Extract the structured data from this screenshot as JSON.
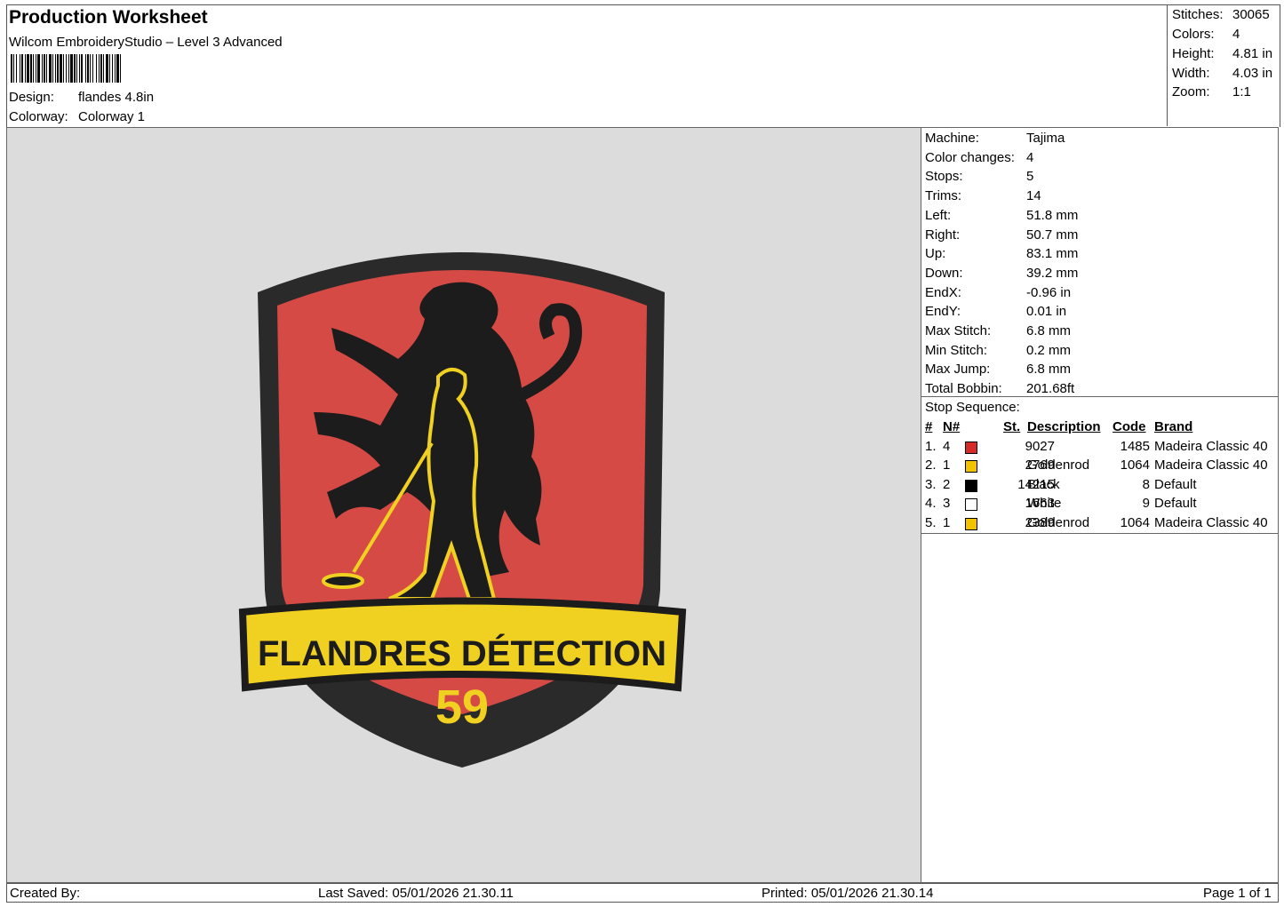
{
  "header": {
    "title": "Production Worksheet",
    "software": "Wilcom EmbroideryStudio – Level 3 Advanced",
    "design_label": "Design:",
    "design_value": "flandes 4.8in",
    "colorway_label": "Colorway:",
    "colorway_value": "Colorway 1"
  },
  "stats": {
    "stitches_label": "Stitches:",
    "stitches": "30065",
    "colors_label": "Colors:",
    "colors": "4",
    "height_label": "Height:",
    "height": "4.81 in",
    "width_label": "Width:",
    "width": "4.03 in",
    "zoom_label": "Zoom:",
    "zoom": "1:1"
  },
  "machine_info": [
    {
      "label": "Machine:",
      "value": "Tajima"
    },
    {
      "label": "Color changes:",
      "value": "4"
    },
    {
      "label": "Stops:",
      "value": "5"
    },
    {
      "label": "Trims:",
      "value": "14"
    },
    {
      "label": "Left:",
      "value": "51.8 mm"
    },
    {
      "label": "Right:",
      "value": "50.7 mm"
    },
    {
      "label": "Up:",
      "value": "83.1 mm"
    },
    {
      "label": "Down:",
      "value": "39.2 mm"
    },
    {
      "label": "EndX:",
      "value": "-0.96 in"
    },
    {
      "label": "EndY:",
      "value": "0.01 in"
    },
    {
      "label": "Max Stitch:",
      "value": "6.8 mm"
    },
    {
      "label": "Min Stitch:",
      "value": "0.2 mm"
    },
    {
      "label": "Max Jump:",
      "value": "6.8 mm"
    },
    {
      "label": "Total Bobbin:",
      "value": "201.68ft"
    }
  ],
  "stop_sequence": {
    "title": "Stop Sequence:",
    "headers": {
      "num": "#",
      "n": "N#",
      "st": "St.",
      "description": "Description",
      "code": "Code",
      "brand": "Brand"
    },
    "rows": [
      {
        "num": "1.",
        "n": "4",
        "color": "#d42a2a",
        "st": "9027",
        "description": "",
        "code": "1485",
        "brand": "Madeira Classic 40"
      },
      {
        "num": "2.",
        "n": "1",
        "color": "#f2c200",
        "st": "2769",
        "description": "Goldenrod",
        "code": "1064",
        "brand": "Madeira Classic 40"
      },
      {
        "num": "3.",
        "n": "2",
        "color": "#000000",
        "st": "14215",
        "description": "Black",
        "code": "8",
        "brand": "Default"
      },
      {
        "num": "4.",
        "n": "3",
        "color": "#ffffff",
        "st": "1663",
        "description": "White",
        "code": "9",
        "brand": "Default"
      },
      {
        "num": "5.",
        "n": "1",
        "color": "#f2c200",
        "st": "2389",
        "description": "Goldenrod",
        "code": "1064",
        "brand": "Madeira Classic 40"
      }
    ]
  },
  "design": {
    "banner_text": "FLANDRES DÉTECTION",
    "number_text": "59",
    "colors": {
      "red": "#d64a45",
      "black": "#1c1c1c",
      "yellow": "#f0d020",
      "border": "#2a2a2a"
    }
  },
  "footer": {
    "created_by": "Created By:",
    "last_saved": "Last Saved: 05/01/2026 21.30.11",
    "printed": "Printed: 05/01/2026 21.30.14",
    "page": "Page 1 of 1"
  }
}
